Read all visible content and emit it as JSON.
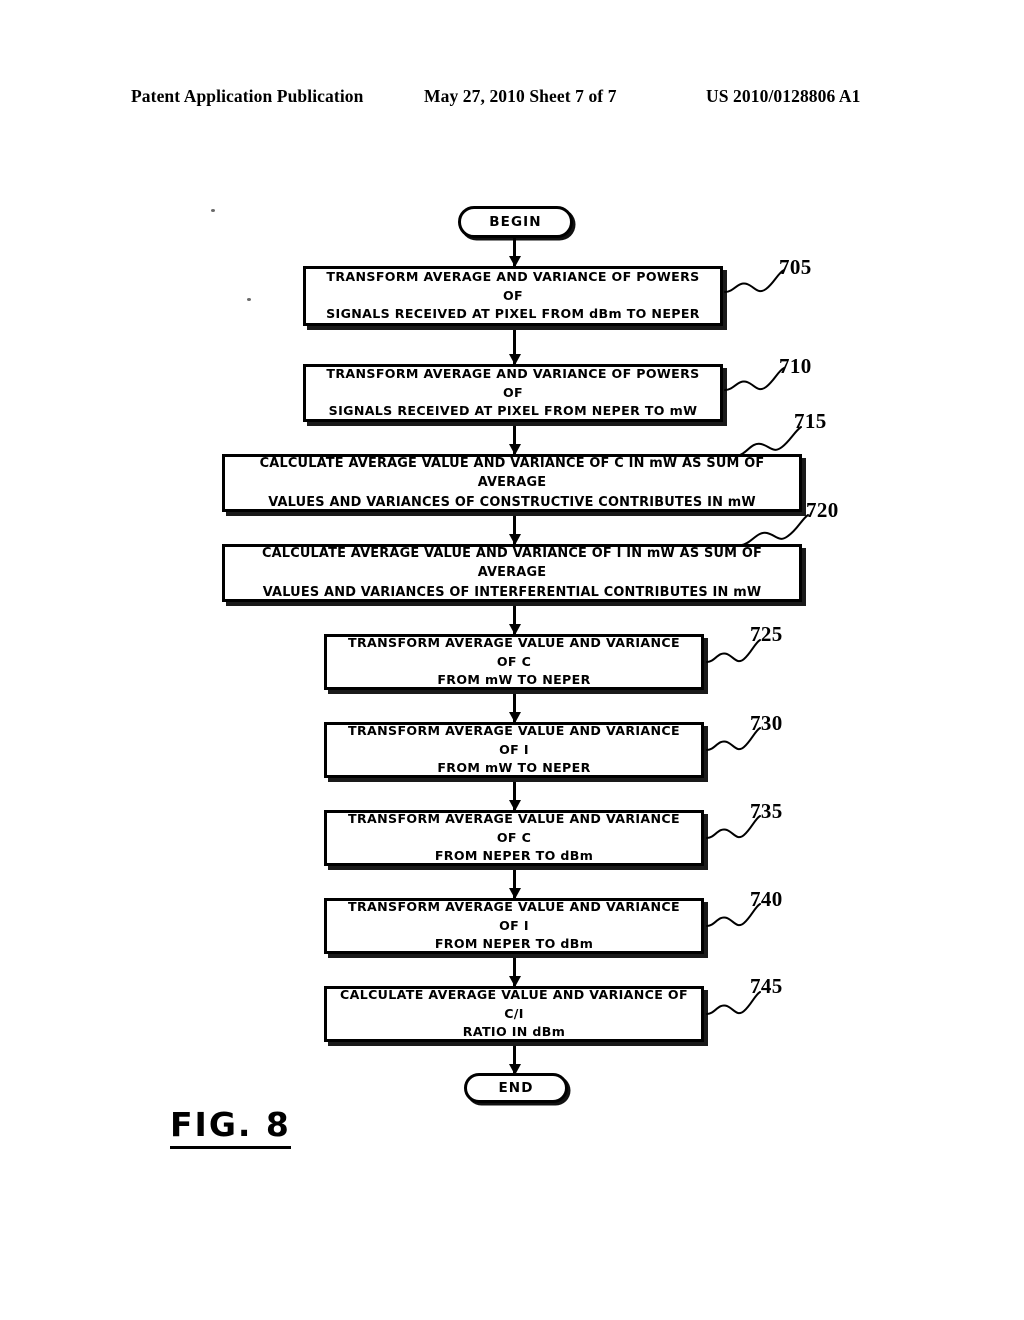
{
  "header": {
    "left": "Patent Application Publication",
    "middle": "May 27, 2010  Sheet 7 of 7",
    "right": "US 2010/0128806 A1"
  },
  "figure": {
    "label": "FIG. 8",
    "type": "flowchart"
  },
  "flowchart": {
    "start_label": "BEGIN",
    "end_label": "END",
    "steps": [
      {
        "ref": "705",
        "text": "TRANSFORM AVERAGE AND VARIANCE OF POWERS OF\nSIGNALS RECEIVED AT PIXEL FROM dBm TO NEPER"
      },
      {
        "ref": "710",
        "text": "TRANSFORM AVERAGE AND VARIANCE OF POWERS OF\nSIGNALS RECEIVED AT PIXEL FROM NEPER TO mW"
      },
      {
        "ref": "715",
        "text": "CALCULATE AVERAGE VALUE AND VARIANCE OF C IN mW AS SUM OF AVERAGE\nVALUES AND VARIANCES OF CONSTRUCTIVE CONTRIBUTES IN mW"
      },
      {
        "ref": "720",
        "text": "CALCULATE AVERAGE VALUE AND VARIANCE OF I IN mW AS SUM OF AVERAGE\nVALUES AND VARIANCES OF INTERFERENTIAL CONTRIBUTES IN mW"
      },
      {
        "ref": "725",
        "text": "TRANSFORM AVERAGE VALUE AND VARIANCE OF C\nFROM mW TO NEPER"
      },
      {
        "ref": "730",
        "text": "TRANSFORM AVERAGE VALUE AND VARIANCE OF I\nFROM mW TO NEPER"
      },
      {
        "ref": "735",
        "text": "TRANSFORM AVERAGE VALUE AND VARIANCE OF C\nFROM NEPER TO dBm"
      },
      {
        "ref": "740",
        "text": "TRANSFORM AVERAGE VALUE AND VARIANCE OF I\nFROM NEPER TO dBm"
      },
      {
        "ref": "745",
        "text": "CALCULATE AVERAGE VALUE AND VARIANCE OF C/I\nRATIO IN dBm"
      }
    ]
  },
  "colors": {
    "ink": "#000000",
    "paper": "#ffffff"
  }
}
